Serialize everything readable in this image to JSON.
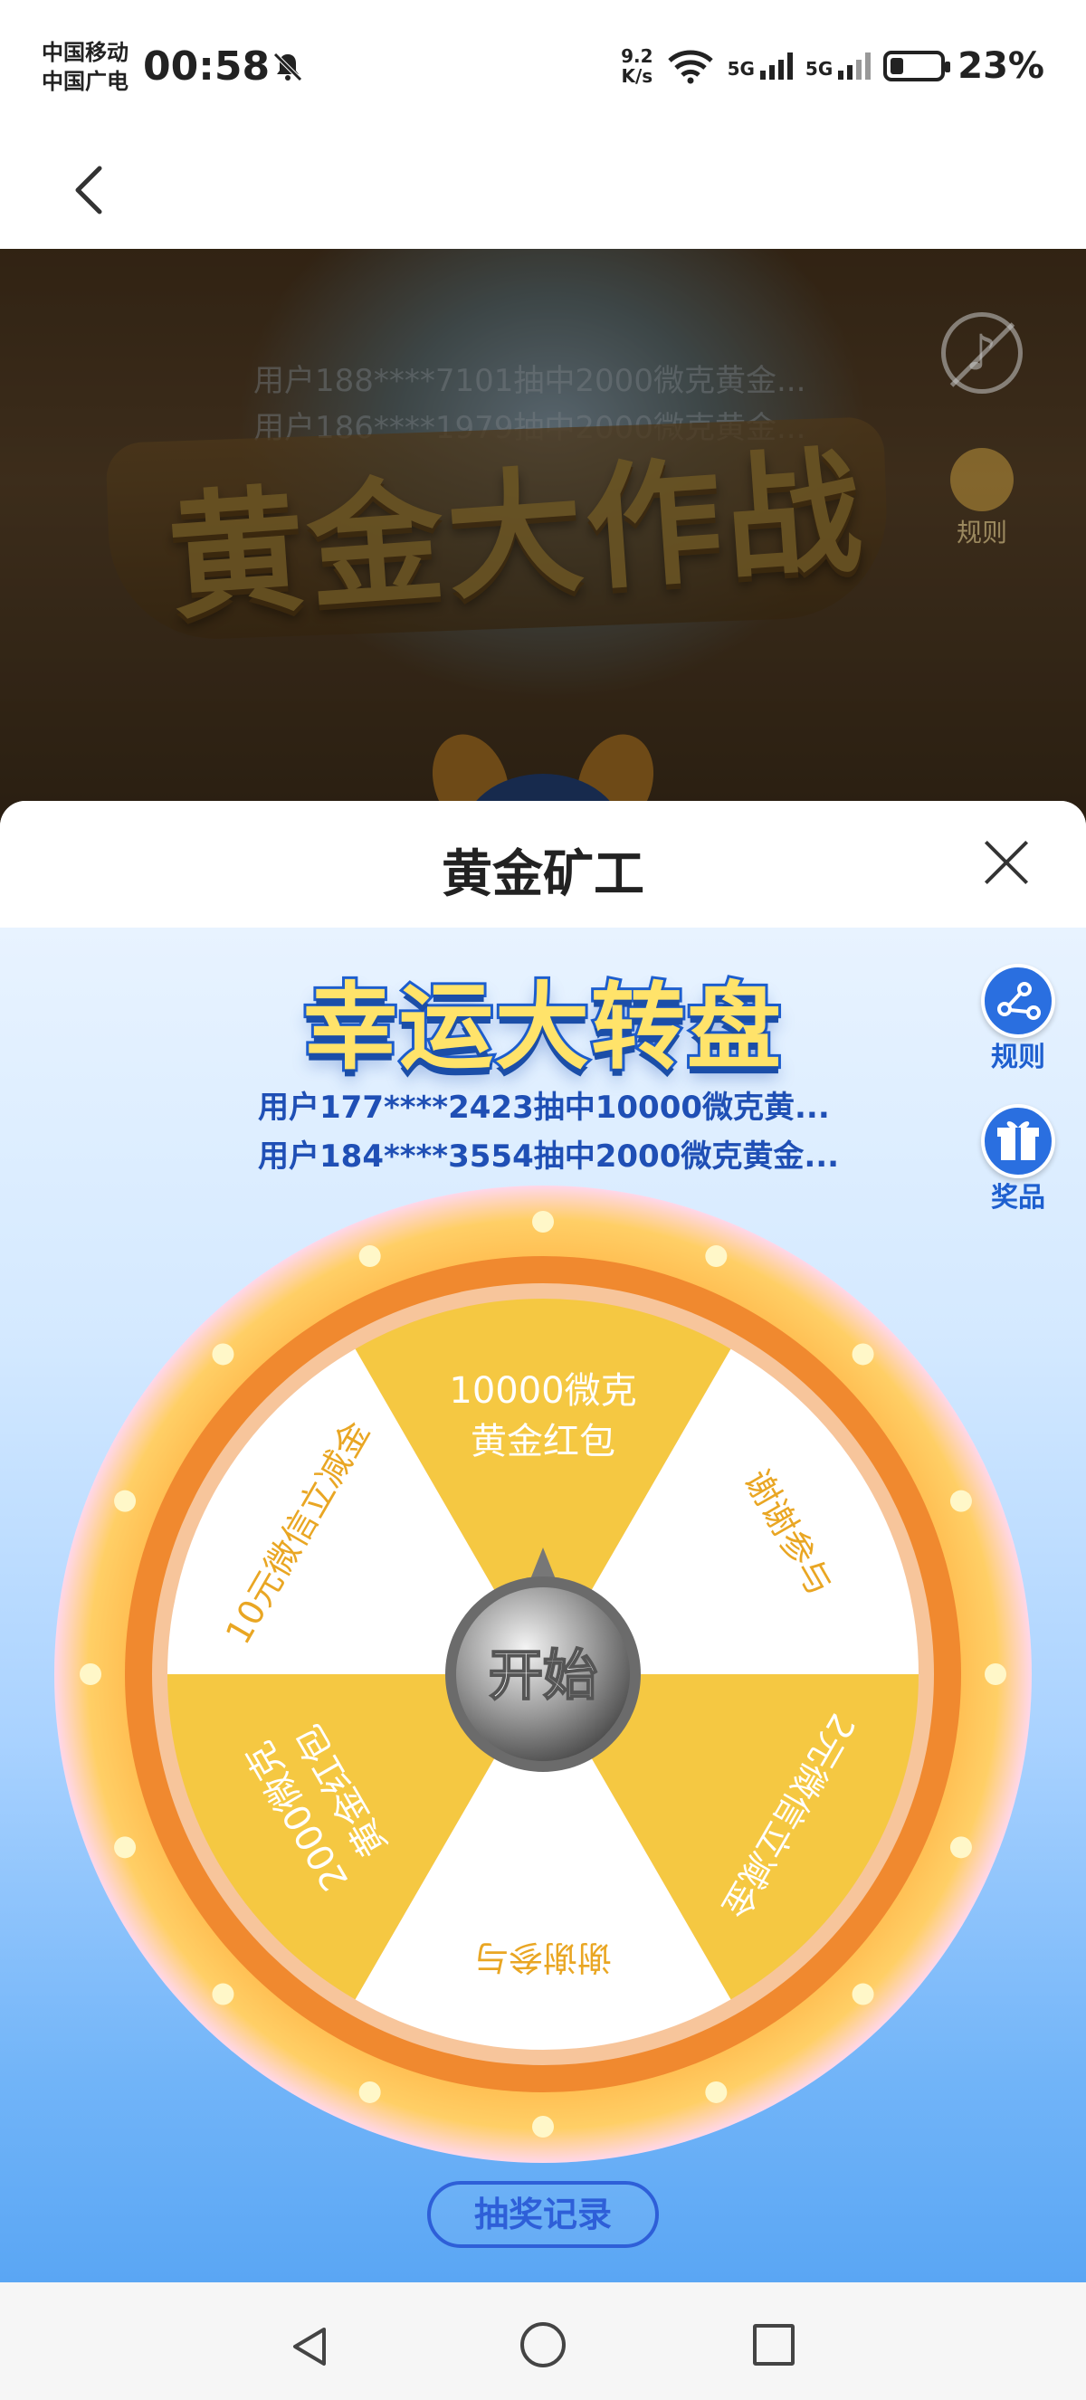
{
  "status_bar": {
    "carrier_1": "中国移动",
    "carrier_2": "中国广电",
    "time": "00:58",
    "net_speed_value": "9.2",
    "net_speed_unit": "K/s",
    "signal_1": "5G",
    "signal_2": "5G",
    "battery": "23%"
  },
  "banner": {
    "title": "黄金大作战",
    "marquee_1": "用户188****7101抽中2000微克黄金...",
    "marquee_2": "用户186****1979抽中2000微克黄金...",
    "rule_label": "规则"
  },
  "sheet": {
    "title": "黄金矿工",
    "game_title": "幸运大转盘",
    "winners": [
      "用户177****2423抽中10000微克黄...",
      "用户184****3554抽中2000微克黄金..."
    ],
    "rule_label": "规则",
    "prize_label": "奖品",
    "start_label": "开始",
    "record_label": "抽奖记录"
  },
  "wheel": {
    "segments": [
      {
        "line1": "10000微克",
        "line2": "黄金红包",
        "color": "#f5c842"
      },
      {
        "line1": "谢谢参与",
        "line2": "",
        "color": "#ffffff"
      },
      {
        "line1": "2元微信立减金",
        "line2": "",
        "color": "#f5c842"
      },
      {
        "line1": "谢谢参与",
        "line2": "",
        "color": "#ffffff"
      },
      {
        "line1": "2000微克",
        "line2": "黄金红包",
        "color": "#f5c842"
      },
      {
        "line1": "10元微信立减金",
        "line2": "",
        "color": "#ffffff"
      }
    ],
    "rim_color": "#f0892f",
    "text_color": "#e9a623"
  },
  "icons": {
    "back": "chevron-left-icon",
    "close": "close-icon",
    "music": "music-muted-icon",
    "share": "share-icon",
    "gift": "gift-icon"
  }
}
